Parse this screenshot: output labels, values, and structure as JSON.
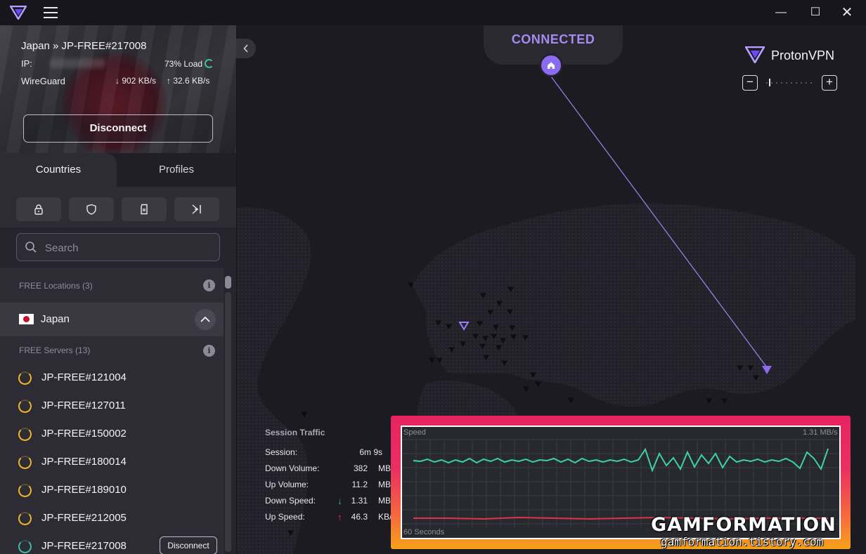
{
  "titlebar": {
    "minimize": "—",
    "maximize": "☐",
    "close": "✕"
  },
  "connection": {
    "server_title": "Japan » JP-FREE#217008",
    "ip_label": "IP:",
    "load": "73% Load",
    "protocol": "WireGuard",
    "down_speed": "↓ 902 KB/s",
    "up_speed": "↑ 32.6 KB/s",
    "load_percent": 73,
    "disconnect_label": "Disconnect"
  },
  "tabs": {
    "countries": "Countries",
    "profiles": "Profiles"
  },
  "features": [
    "secure-core-icon",
    "netshield-icon",
    "port-forwarding-icon",
    "split-tunneling-icon"
  ],
  "search": {
    "placeholder": "Search"
  },
  "list": {
    "free_locations": "FREE Locations (3)",
    "country": "Japan",
    "free_servers": "FREE Servers (13)",
    "servers": [
      {
        "name": "JP-FREE#121004",
        "status_color": "#f0b72e"
      },
      {
        "name": "JP-FREE#127011",
        "status_color": "#f0b72e"
      },
      {
        "name": "JP-FREE#150002",
        "status_color": "#f0b72e"
      },
      {
        "name": "JP-FREE#180014",
        "status_color": "#f0b72e"
      },
      {
        "name": "JP-FREE#189010",
        "status_color": "#f0b72e"
      },
      {
        "name": "JP-FREE#212005",
        "status_color": "#f0b72e"
      },
      {
        "name": "JP-FREE#217008",
        "status_color": "#3fbf9f"
      }
    ],
    "active_disconnect": "Disconnect"
  },
  "map": {
    "status": "CONNECTED",
    "brand": "ProtonVPN",
    "brand_proton": "Proton",
    "brand_vpn": "VPN",
    "zoom_minus": "−",
    "zoom_plus": "+",
    "accent_color": "#8b6cf0"
  },
  "session": {
    "title": "Session Traffic",
    "rows": [
      {
        "label": "Session:",
        "value": "6m 9s",
        "unit": ""
      },
      {
        "label": "Down Volume:",
        "value": "382",
        "unit": "MB"
      },
      {
        "label": "Up Volume:",
        "value": "11.2",
        "unit": "MB"
      },
      {
        "label": "Down Speed:",
        "value": "1.31",
        "unit": "MB",
        "arrow": "↓"
      },
      {
        "label": "Up Speed:",
        "value": "46.3",
        "unit": "KB/",
        "arrow": "↑"
      }
    ]
  },
  "graph": {
    "title": "Speed",
    "max_label": "1.31 MB/s",
    "window_label": "60 Seconds",
    "series_colors": {
      "download": "#3fd1a6",
      "upload": "#e0334d"
    }
  },
  "watermark": {
    "title": "GAMFORMATION",
    "url": "gamformation.tistory.com"
  }
}
